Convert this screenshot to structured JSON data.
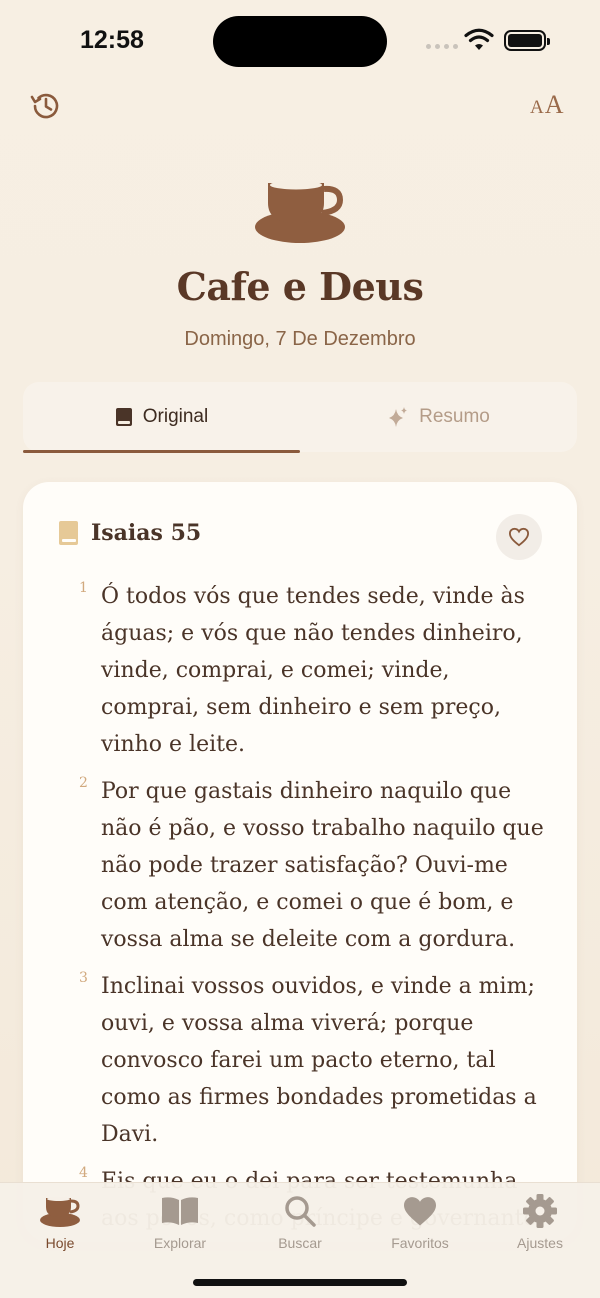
{
  "status": {
    "time": "12:58"
  },
  "header": {
    "app_title": "Cafe e Deus",
    "date": "Domingo, 7 De Dezembro",
    "font_size_label_small": "A",
    "font_size_label_large": "A"
  },
  "tabs": [
    {
      "label": "Original",
      "icon": "book-icon",
      "active": true
    },
    {
      "label": "Resumo",
      "icon": "sparkle-icon",
      "active": false
    }
  ],
  "chapter": {
    "title": "Isaias 55",
    "verses": [
      {
        "num": "1",
        "text": "Ó todos vós que tendes sede, vinde às águas; e vós que não tendes dinheiro, vinde, comprai, e comei; vinde, comprai, sem dinheiro e sem preço, vinho e leite."
      },
      {
        "num": "2",
        "text": "Por que gastais dinheiro naquilo que não é pão, e vosso trabalho naquilo que não pode trazer satisfação? Ouvi-me com atenção, e comei o que é bom, e vossa alma se deleite com a gordura."
      },
      {
        "num": "3",
        "text": "Inclinai vossos ouvidos, e vinde a mim; ouvi, e vossa alma viverá; porque convosco farei um pacto eterno, tal como as firmes bondades prometidas a Davi."
      },
      {
        "num": "4",
        "text": "Eis que eu o dei para ser testemunha aos povos, como príncipe e governante"
      }
    ]
  },
  "tab_bar": [
    {
      "label": "Hoje",
      "icon": "coffee-cup-icon",
      "active": true
    },
    {
      "label": "Explorar",
      "icon": "open-book-icon",
      "active": false
    },
    {
      "label": "Buscar",
      "icon": "search-icon",
      "active": false
    },
    {
      "label": "Favoritos",
      "icon": "heart-icon",
      "active": false
    },
    {
      "label": "Ajustes",
      "icon": "gear-icon",
      "active": false
    }
  ],
  "colors": {
    "accent": "#8a5a3c",
    "background": "#f6eee2",
    "card": "#fffdf9",
    "verse_number": "#d1a97e"
  }
}
